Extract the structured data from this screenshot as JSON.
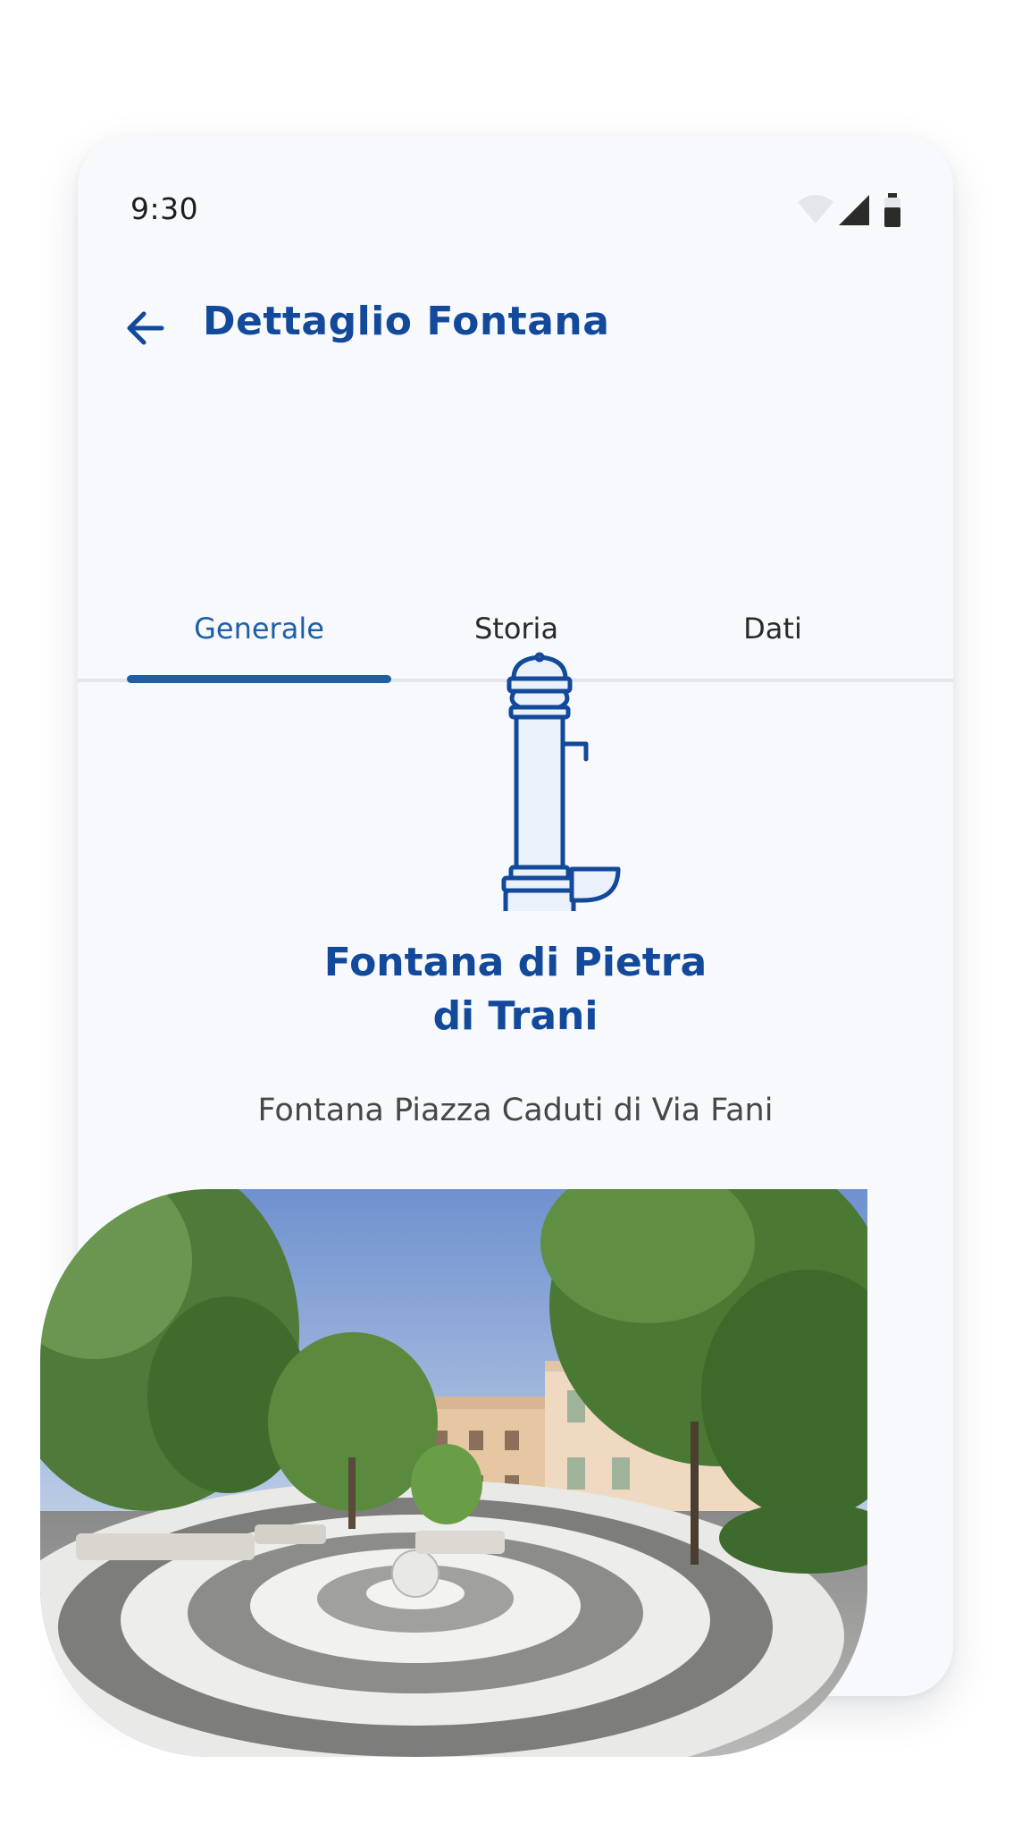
{
  "status_bar": {
    "time": "9:30",
    "icons": [
      "wifi-icon",
      "signal-icon",
      "battery-icon"
    ]
  },
  "header": {
    "back_icon": "arrow-left-icon",
    "title": "Dettaglio Fontana"
  },
  "tabs": [
    {
      "label": "Generale",
      "active": true
    },
    {
      "label": "Storia",
      "active": false
    },
    {
      "label": "Dati",
      "active": false
    }
  ],
  "fountain": {
    "icon": "fountain-icon",
    "name_line1": "Fontana di Pietra",
    "name_line2": "di Trani",
    "location": "Fontana Piazza Caduti di Via Fani"
  },
  "photo": {
    "subject": "piazza-photo"
  },
  "colors": {
    "primary": "#12499a",
    "accent": "#1e5fa8",
    "background": "#f7f9fc",
    "icon_fill": "#eaf1fb"
  }
}
